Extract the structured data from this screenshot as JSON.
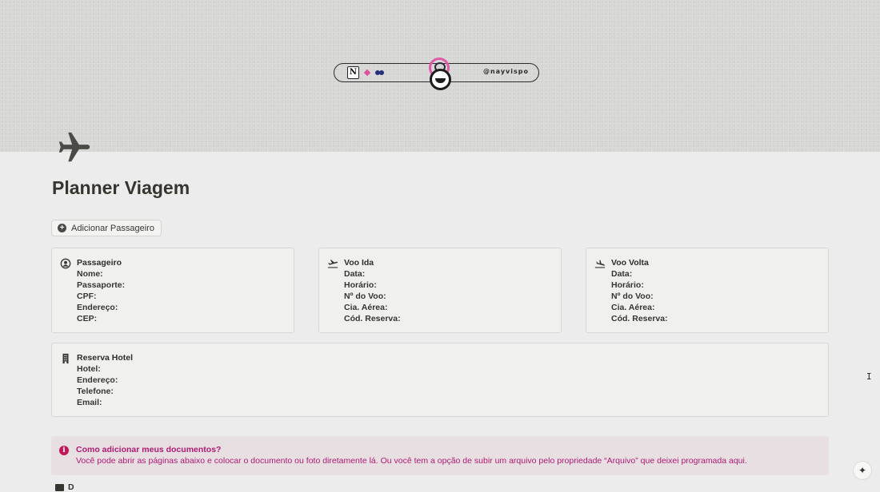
{
  "cover": {
    "logo_handle": "@nayvispo",
    "logo_icon": "notion-logo",
    "accent_pink": "#e05aa8",
    "accent_navy": "#23307a"
  },
  "page": {
    "icon": "airplane-icon",
    "title": "Planner Viagem"
  },
  "add_passenger_button": {
    "label": "Adicionar Passageiro",
    "icon": "plus-circle-icon"
  },
  "cards": {
    "passenger": {
      "icon": "user-circle-icon",
      "title": "Passageiro",
      "fields": [
        "Nome:",
        "Passaporte:",
        "CPF:",
        "Endereço:",
        "CEP:"
      ]
    },
    "outbound": {
      "icon": "plane-takeoff-icon",
      "title": "Voo Ida",
      "fields": [
        "Data:",
        "Horário:",
        "Nº do Voo:",
        "Cia. Aérea:",
        "Cód. Reserva:"
      ]
    },
    "return": {
      "icon": "plane-landing-icon",
      "title": "Voo Volta",
      "fields": [
        "Data:",
        "Horário:",
        "Nº do Voo:",
        "Cia. Aérea:",
        "Cód. Reserva:"
      ]
    },
    "hotel": {
      "icon": "building-icon",
      "title": "Reserva Hotel",
      "fields": [
        "Hotel:",
        "Endereço:",
        "Telefone:",
        "Email:"
      ]
    }
  },
  "callout": {
    "icon": "info-icon",
    "title": "Como adicionar meus documentos?",
    "text": "Você pode abrir as páginas abaixo e colocar o documento ou foto diretamente lá. Ou você tem a opção de subir um arquivo pelo propriedade “Arquivo” que deixei programada aqui.",
    "color": "#ad1a72",
    "background": "#e8dfe3"
  },
  "documents_row": {
    "icon": "folder-icon",
    "label": "D"
  },
  "ai_button": {
    "icon": "sparkle-icon"
  }
}
